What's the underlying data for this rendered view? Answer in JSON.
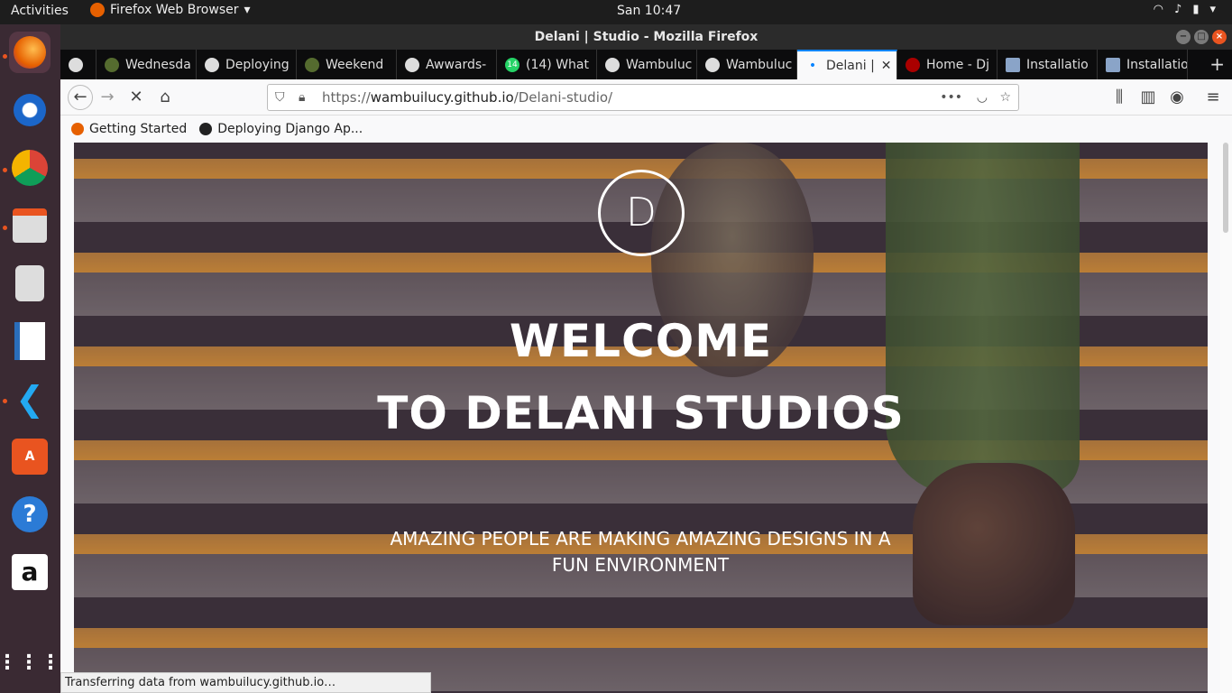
{
  "topbar": {
    "activities": "Activities",
    "app_name": "Firefox Web Browser",
    "clock": "San 10:47"
  },
  "window": {
    "title": "Delani | Studio - Mozilla Firefox"
  },
  "tabs": [
    {
      "label": "",
      "icon": "github-icon"
    },
    {
      "label": "Wednesda",
      "icon": "github-icon"
    },
    {
      "label": "Deploying",
      "icon": "github-icon"
    },
    {
      "label": "Weekend",
      "icon": "github-icon"
    },
    {
      "label": "Awwards-",
      "icon": "github-icon"
    },
    {
      "label": "(14) What",
      "icon": "whatsapp-icon"
    },
    {
      "label": "Wambuluc",
      "icon": "github-icon"
    },
    {
      "label": "Wambuluc",
      "icon": "github-icon"
    },
    {
      "label": "Delani |",
      "icon": "loading-dot-icon"
    },
    {
      "label": "Home - Dj",
      "icon": "django-icon"
    },
    {
      "label": "Installatio",
      "icon": "doc-icon"
    },
    {
      "label": "Installatio",
      "icon": "doc-icon"
    }
  ],
  "url": {
    "prefix": "https://",
    "domain": "wambuilucy.github.io",
    "path": "/Delani-studio/"
  },
  "bookmarks": [
    {
      "label": "Getting Started",
      "icon": "firefox-icon"
    },
    {
      "label": "Deploying Django Ap...",
      "icon": "github-icon"
    }
  ],
  "hero": {
    "logo_letter": "D",
    "title_line1": "WELCOME",
    "title_line2": "TO DELANI STUDIOS",
    "subtitle": "AMAZING PEOPLE ARE MAKING AMAZING DESIGNS IN A FUN ENVIRONMENT"
  },
  "status": "Transferring data from wambuilucy.github.io…"
}
